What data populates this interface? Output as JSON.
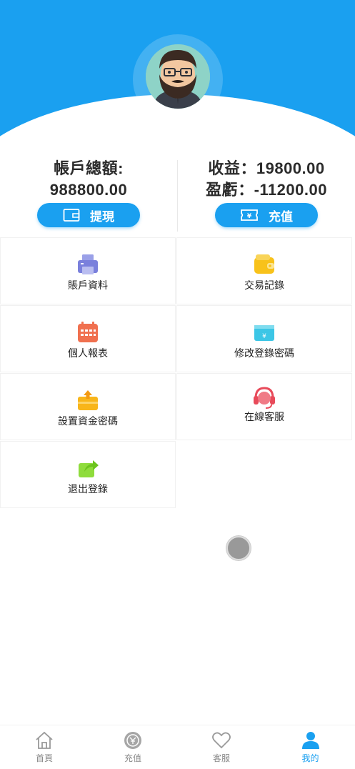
{
  "profile": {
    "avatar_icon": "bearded-man-avatar"
  },
  "balance": {
    "total_label": "帳戶總額:",
    "total_value": "988800.00",
    "income_line": "收益：19800.00",
    "loss_line": "盈虧：-11200.00",
    "withdraw_label": "提現",
    "recharge_label": "充值"
  },
  "menu": {
    "account_info": "賬戶資料",
    "transactions": "交易記錄",
    "personal_report": "個人報表",
    "change_login_password": "修改登錄密碼",
    "set_fund_password": "設置資金密碼",
    "online_support": "在線客服",
    "logout": "退出登錄"
  },
  "tabbar": {
    "home": "首頁",
    "recharge": "充值",
    "support": "客服",
    "mine": "我的",
    "active": "mine"
  },
  "colors": {
    "brand": "#1aa0f0",
    "inactive": "#888888"
  }
}
